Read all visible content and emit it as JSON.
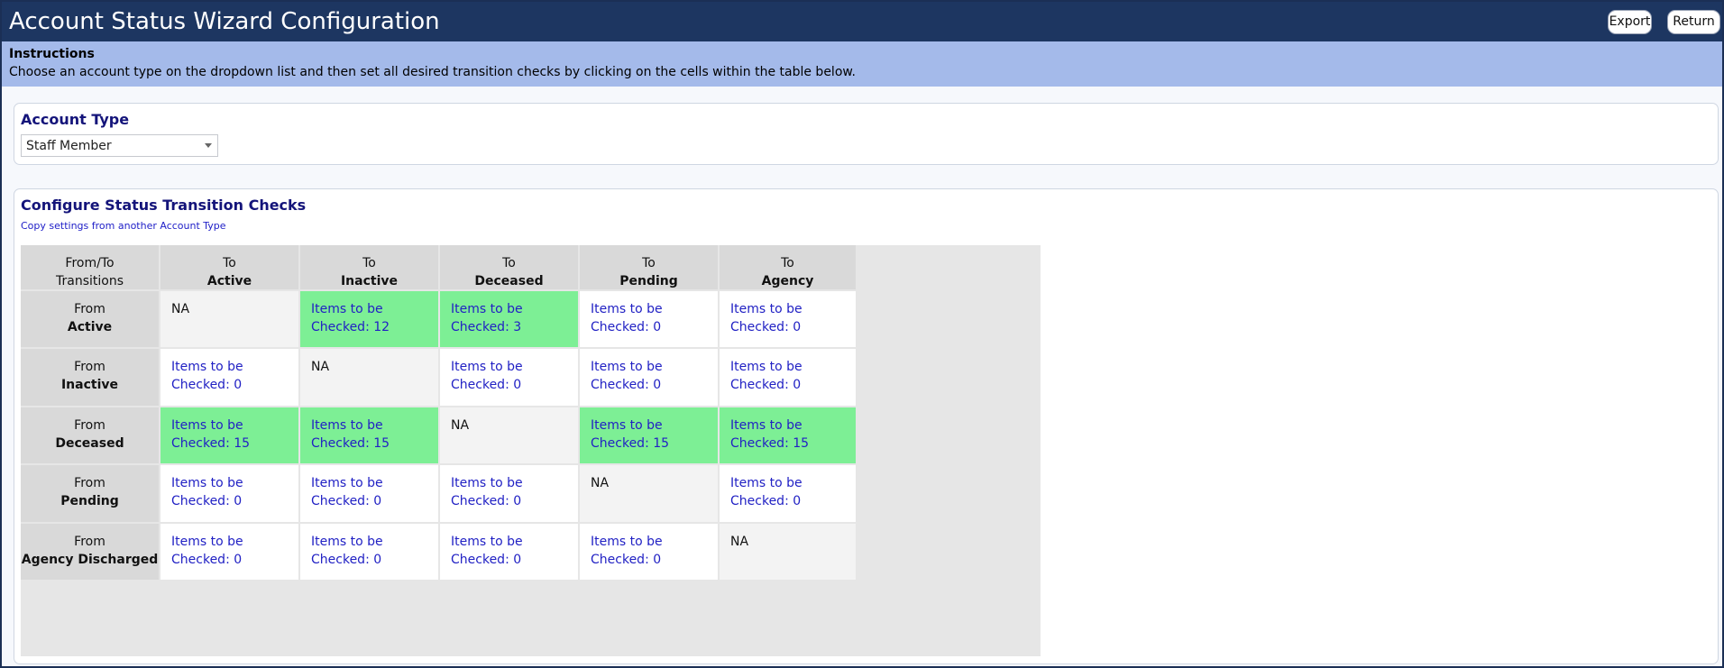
{
  "window": {
    "title": "Account Status Wizard Configuration",
    "export_label": "Export",
    "return_label": "Return"
  },
  "instructions": {
    "heading": "Instructions",
    "text": "Choose an account type on the dropdown list and then set all desired transition checks by clicking on the cells within the table below."
  },
  "account_type": {
    "heading": "Account Type",
    "selected": "Staff Member"
  },
  "config": {
    "heading": "Configure Status Transition Checks",
    "copy_link": "Copy settings from another Account Type",
    "corner_line1": "From/To",
    "corner_line2": "Transitions",
    "to_prefix": "To",
    "from_prefix": "From",
    "columns": [
      "Active",
      "Inactive",
      "Deceased",
      "Pending",
      "Agency Discharged"
    ],
    "rows": [
      {
        "status": "Active",
        "cells": [
          {
            "text": "NA",
            "state": "na"
          },
          {
            "text": "Items to be Checked: 12",
            "state": "checked"
          },
          {
            "text": "Items to be Checked: 3",
            "state": "checked"
          },
          {
            "text": "Items to be Checked: 0",
            "state": "empty"
          },
          {
            "text": "Items to be Checked: 0",
            "state": "empty"
          }
        ]
      },
      {
        "status": "Inactive",
        "cells": [
          {
            "text": "Items to be Checked: 0",
            "state": "empty"
          },
          {
            "text": "NA",
            "state": "na"
          },
          {
            "text": "Items to be Checked: 0",
            "state": "empty"
          },
          {
            "text": "Items to be Checked: 0",
            "state": "empty"
          },
          {
            "text": "Items to be Checked: 0",
            "state": "empty"
          }
        ]
      },
      {
        "status": "Deceased",
        "cells": [
          {
            "text": "Items to be Checked: 15",
            "state": "checked"
          },
          {
            "text": "Items to be Checked: 15",
            "state": "checked"
          },
          {
            "text": "NA",
            "state": "na"
          },
          {
            "text": "Items to be Checked: 15",
            "state": "checked"
          },
          {
            "text": "Items to be Checked: 15",
            "state": "checked"
          }
        ]
      },
      {
        "status": "Pending",
        "cells": [
          {
            "text": "Items to be Checked: 0",
            "state": "empty"
          },
          {
            "text": "Items to be Checked: 0",
            "state": "empty"
          },
          {
            "text": "Items to be Checked: 0",
            "state": "empty"
          },
          {
            "text": "NA",
            "state": "na"
          },
          {
            "text": "Items to be Checked: 0",
            "state": "empty"
          }
        ]
      },
      {
        "status": "Agency Discharged",
        "cells": [
          {
            "text": "Items to be Checked: 0",
            "state": "empty"
          },
          {
            "text": "Items to be Checked: 0",
            "state": "empty"
          },
          {
            "text": "Items to be Checked: 0",
            "state": "empty"
          },
          {
            "text": "Items to be Checked: 0",
            "state": "empty"
          },
          {
            "text": "NA",
            "state": "na"
          }
        ]
      }
    ]
  },
  "colors": {
    "title_bar": "#1d3661",
    "instructions_bg": "#a4baea",
    "checked_cell": "#7def95",
    "header_cell": "#d9d9d9",
    "na_cell": "#f3f3f3",
    "link_text": "#2121c4",
    "heading_text": "#14147a"
  }
}
